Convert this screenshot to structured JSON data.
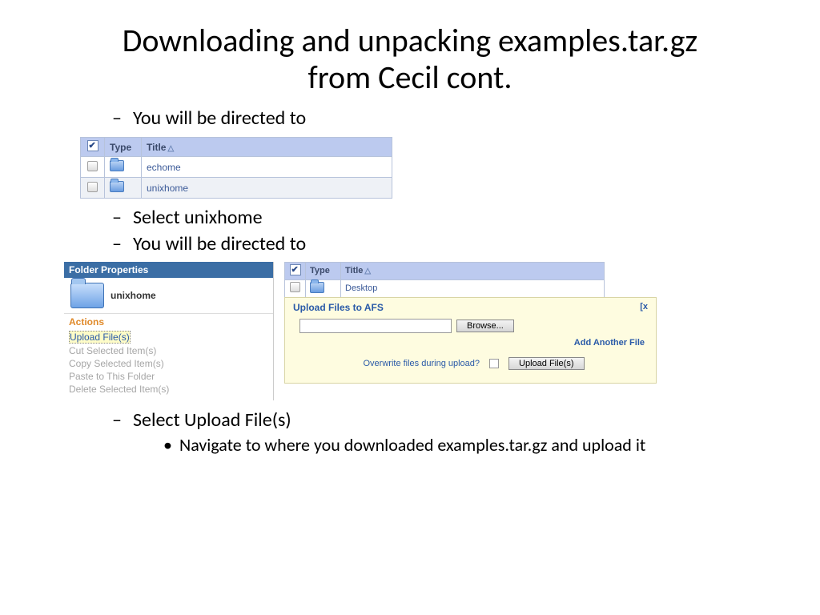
{
  "title": "Downloading and unpacking examples.tar.gz from Cecil cont.",
  "bullets": {
    "b1": "You will be directed to",
    "b2": "Select unixhome",
    "b3": "You will be directed to",
    "b4": "Select Upload File(s)",
    "b4_sub": "Navigate to where you downloaded examples.tar.gz and upload it"
  },
  "table1": {
    "h_type": "Type",
    "h_title": "Title",
    "rows": [
      {
        "title": "echome"
      },
      {
        "title": "unixhome"
      }
    ]
  },
  "props": {
    "header": "Folder Properties",
    "name": "unixhome",
    "actions_header": "Actions",
    "actions": {
      "upload": "Upload File(s)",
      "cut": "Cut Selected Item(s)",
      "copy": "Copy Selected Item(s)",
      "paste": "Paste to This Folder",
      "del": "Delete Selected Item(s)"
    }
  },
  "table2": {
    "h_type": "Type",
    "h_title": "Title",
    "row_title": "Desktop"
  },
  "upload": {
    "title": "Upload Files to AFS",
    "close": "[x",
    "browse": "Browse...",
    "add": "Add Another File",
    "overwrite": "Overwrite files during upload?",
    "submit": "Upload File(s)"
  }
}
